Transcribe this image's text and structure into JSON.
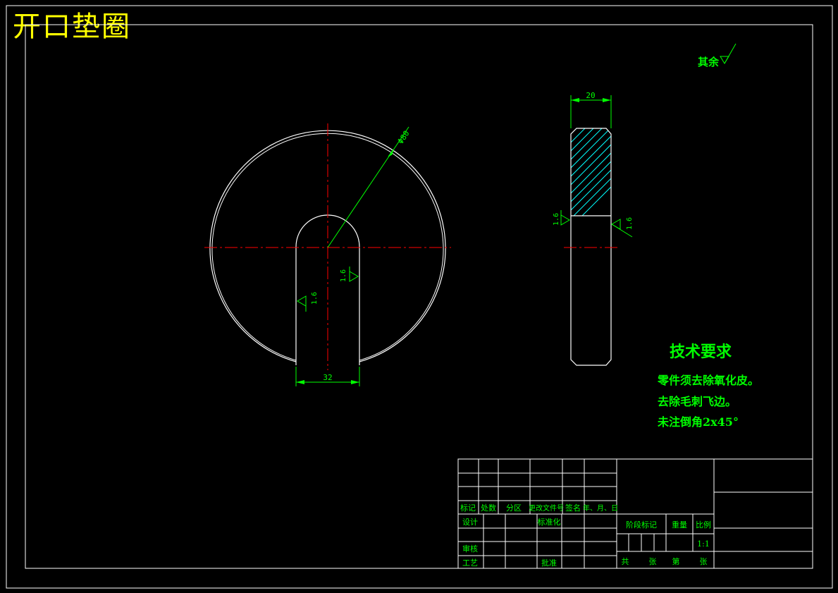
{
  "title": "开口垫圈",
  "surface_note": "其余",
  "dims": {
    "outer_diameter": "Φ80",
    "width": "20",
    "slot_width": "32",
    "roughness": "1.6"
  },
  "tech": {
    "heading": "技术要求",
    "items": [
      "零件须去除氧化皮。",
      "去除毛刺飞边。",
      "未注倒角2x45°"
    ]
  },
  "titleblock": {
    "rev_headers": [
      "标记",
      "处数",
      "分区",
      "更改文件号",
      "签名",
      "年、月、日"
    ],
    "design": "设计",
    "standard": "标准化",
    "stage": "阶段标记",
    "weight": "重量",
    "scale_label": "比例",
    "scale_value": "1:1",
    "review": "审核",
    "process": "工艺",
    "approve": "批准",
    "sheets": [
      "共",
      "张",
      "第",
      "张"
    ]
  },
  "colors": {
    "background": "#000000",
    "geometry": "#ffffff",
    "dimension": "#00ff00",
    "centerline": "#ff0000",
    "section": "#00ffff",
    "title": "#ffff00"
  }
}
